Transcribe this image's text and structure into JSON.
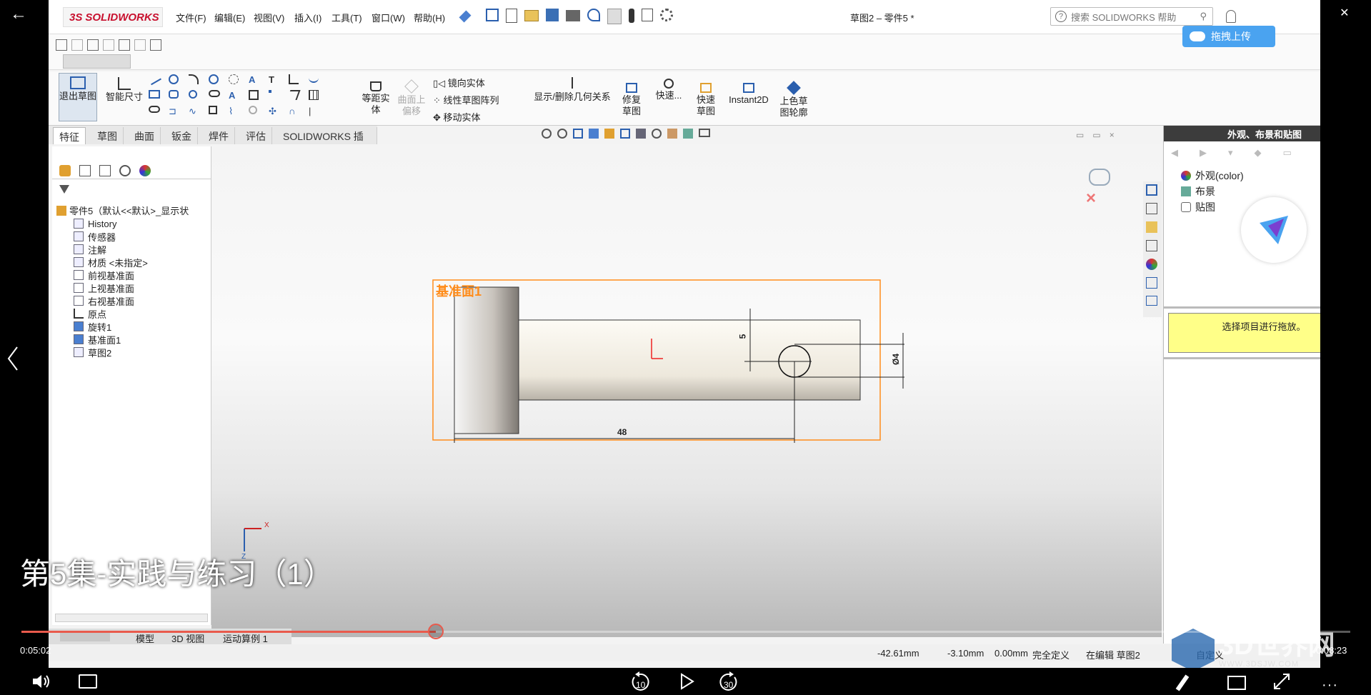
{
  "player": {
    "back_label": "←",
    "subtitle": "第5集-实践与练习（1）",
    "time_current": "0:05:02",
    "time_total": "0:08:23",
    "progress": 0.312,
    "skip_back": "10",
    "skip_fwd": "30",
    "watermark_brand": "3D世界网",
    "watermark_url": "WWW.3DSJW.COM"
  },
  "sw": {
    "logo": "SOLIDWORKS",
    "menu": [
      "文件(F)",
      "编辑(E)",
      "视图(V)",
      "插入(I)",
      "工具(T)",
      "窗口(W)",
      "帮助(H)"
    ],
    "doc_title": "草图2 – 零件5 *",
    "search_placeholder": "搜索 SOLIDWORKS 帮助",
    "upload_label": "拖拽上传",
    "ribbon": {
      "exit_sketch": "退出草图",
      "smart_dim": "智能尺寸",
      "offset": "等距实体",
      "surface_offset": "曲面上偏移",
      "mirror": "镜向实体",
      "linear_pattern": "线性草图阵列",
      "move": "移动实体",
      "relations": "显示/删除几何关系",
      "repair": "修复草图",
      "quick_snap": "快速...",
      "rapid_sketch": "快速草图",
      "instant2d": "Instant2D",
      "shaded_contours": "上色草图轮廓"
    },
    "tabs": [
      "特征",
      "草图",
      "曲面",
      "钣金",
      "焊件",
      "评估",
      "SOLIDWORKS 插件"
    ],
    "tree": {
      "root": "零件5（默认<<默认>_显示状",
      "items": [
        "History",
        "传感器",
        "注解",
        "材质 <未指定>",
        "前视基准面",
        "上视基准面",
        "右视基准面",
        "原点",
        "旋转1",
        "基准面1",
        "草图2"
      ]
    },
    "graphics": {
      "plane_label": "基准面1",
      "dim_5": "5",
      "dim_d4": "Ø4",
      "dim_48": "48",
      "axis_x": "X",
      "axis_z": "Z"
    },
    "right_panel": {
      "title": "外观、布景和贴图",
      "items": [
        "外观(color)",
        "布景",
        "贴图"
      ],
      "note": "选择项目进行拖放。"
    },
    "bottom_tabs": [
      "模型",
      "3D 视图",
      "运动算例 1"
    ],
    "status": {
      "x": "-42.61mm",
      "y": "-3.10mm",
      "z": "0.00mm",
      "state": "完全定义",
      "editing": "在编辑 草图2",
      "custom": "自定义"
    }
  },
  "colors": {
    "plane_border": "#ff8c1a",
    "progress": "#e95a4c",
    "note_bg": "#ffff88"
  }
}
